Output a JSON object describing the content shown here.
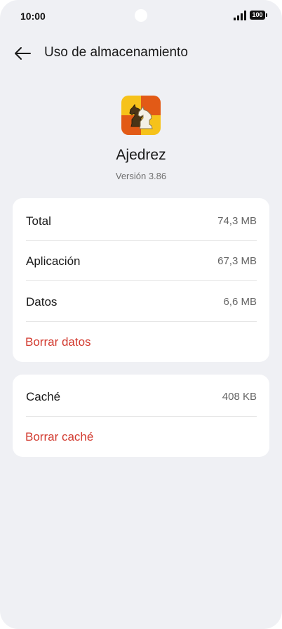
{
  "status_bar": {
    "time": "10:00",
    "battery": "100"
  },
  "header": {
    "title": "Uso de almacenamiento"
  },
  "app": {
    "name": "Ajedrez",
    "version": "Versión 3.86"
  },
  "storage": {
    "rows": [
      {
        "label": "Total",
        "value": "74,3 MB"
      },
      {
        "label": "Aplicación",
        "value": "67,3 MB"
      },
      {
        "label": "Datos",
        "value": "6,6 MB"
      }
    ],
    "clear_data_label": "Borrar datos"
  },
  "cache": {
    "label": "Caché",
    "value": "408 KB",
    "clear_cache_label": "Borrar caché"
  },
  "colors": {
    "background": "#eff0f4",
    "card": "#ffffff",
    "action_red": "#d23a2f"
  },
  "icons": {
    "back": "back-arrow-icon",
    "signal": "signal-icon",
    "battery": "battery-icon",
    "app": "chess-app-icon"
  }
}
